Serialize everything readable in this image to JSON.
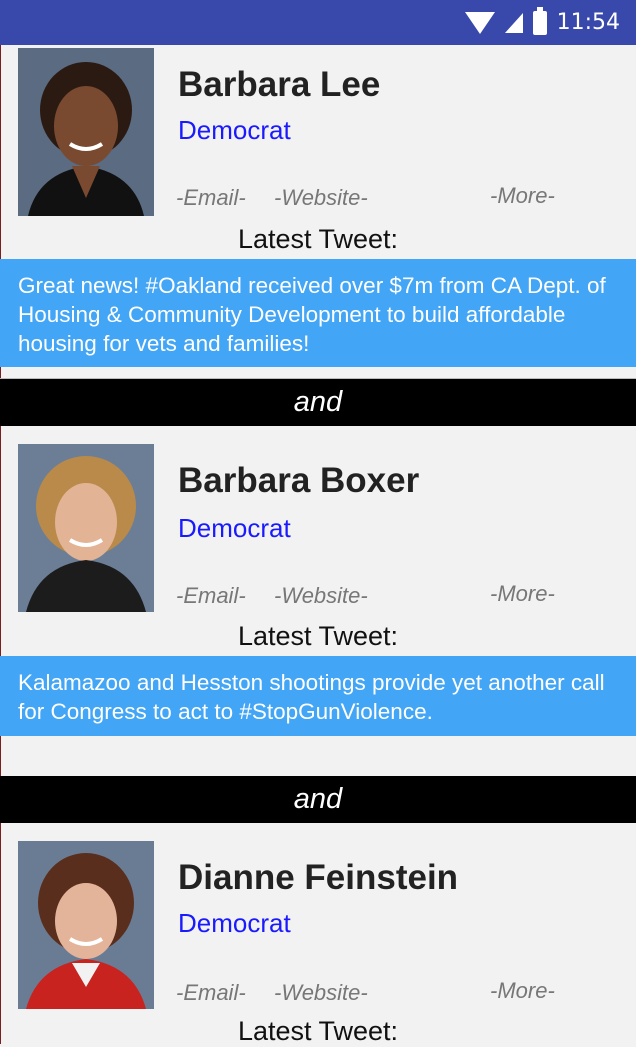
{
  "status_bar": {
    "time": "11:54",
    "icons": [
      "wifi-icon",
      "cell-signal-icon",
      "battery-icon"
    ]
  },
  "senators": [
    {
      "name": "Barbara Lee",
      "party": "Democrat",
      "links": {
        "email": "-Email-",
        "website": "-Website-",
        "more": "-More-"
      },
      "latest_label": "Latest Tweet:",
      "tweet": "Great news! #Oakland received over $7m from CA Dept. of Housing & Community Development to build affordable housing for vets and families!"
    },
    {
      "name": "Barbara Boxer",
      "party": "Democrat",
      "links": {
        "email": "-Email-",
        "website": "-Website-",
        "more": "-More-"
      },
      "latest_label": "Latest Tweet:",
      "tweet": "Kalamazoo and Hesston shootings provide yet another call for Congress to act to #StopGunViolence."
    },
    {
      "name": "Dianne Feinstein",
      "party": "Democrat",
      "links": {
        "email": "-Email-",
        "website": "-Website-",
        "more": "-More-"
      },
      "latest_label": "Latest Tweet:"
    }
  ],
  "dividers": [
    "and",
    "and"
  ],
  "colors": {
    "status_bar": "#3949ab",
    "tweet_bg": "#42a5f5",
    "party": "#1a1aff",
    "divider": "#000000"
  }
}
